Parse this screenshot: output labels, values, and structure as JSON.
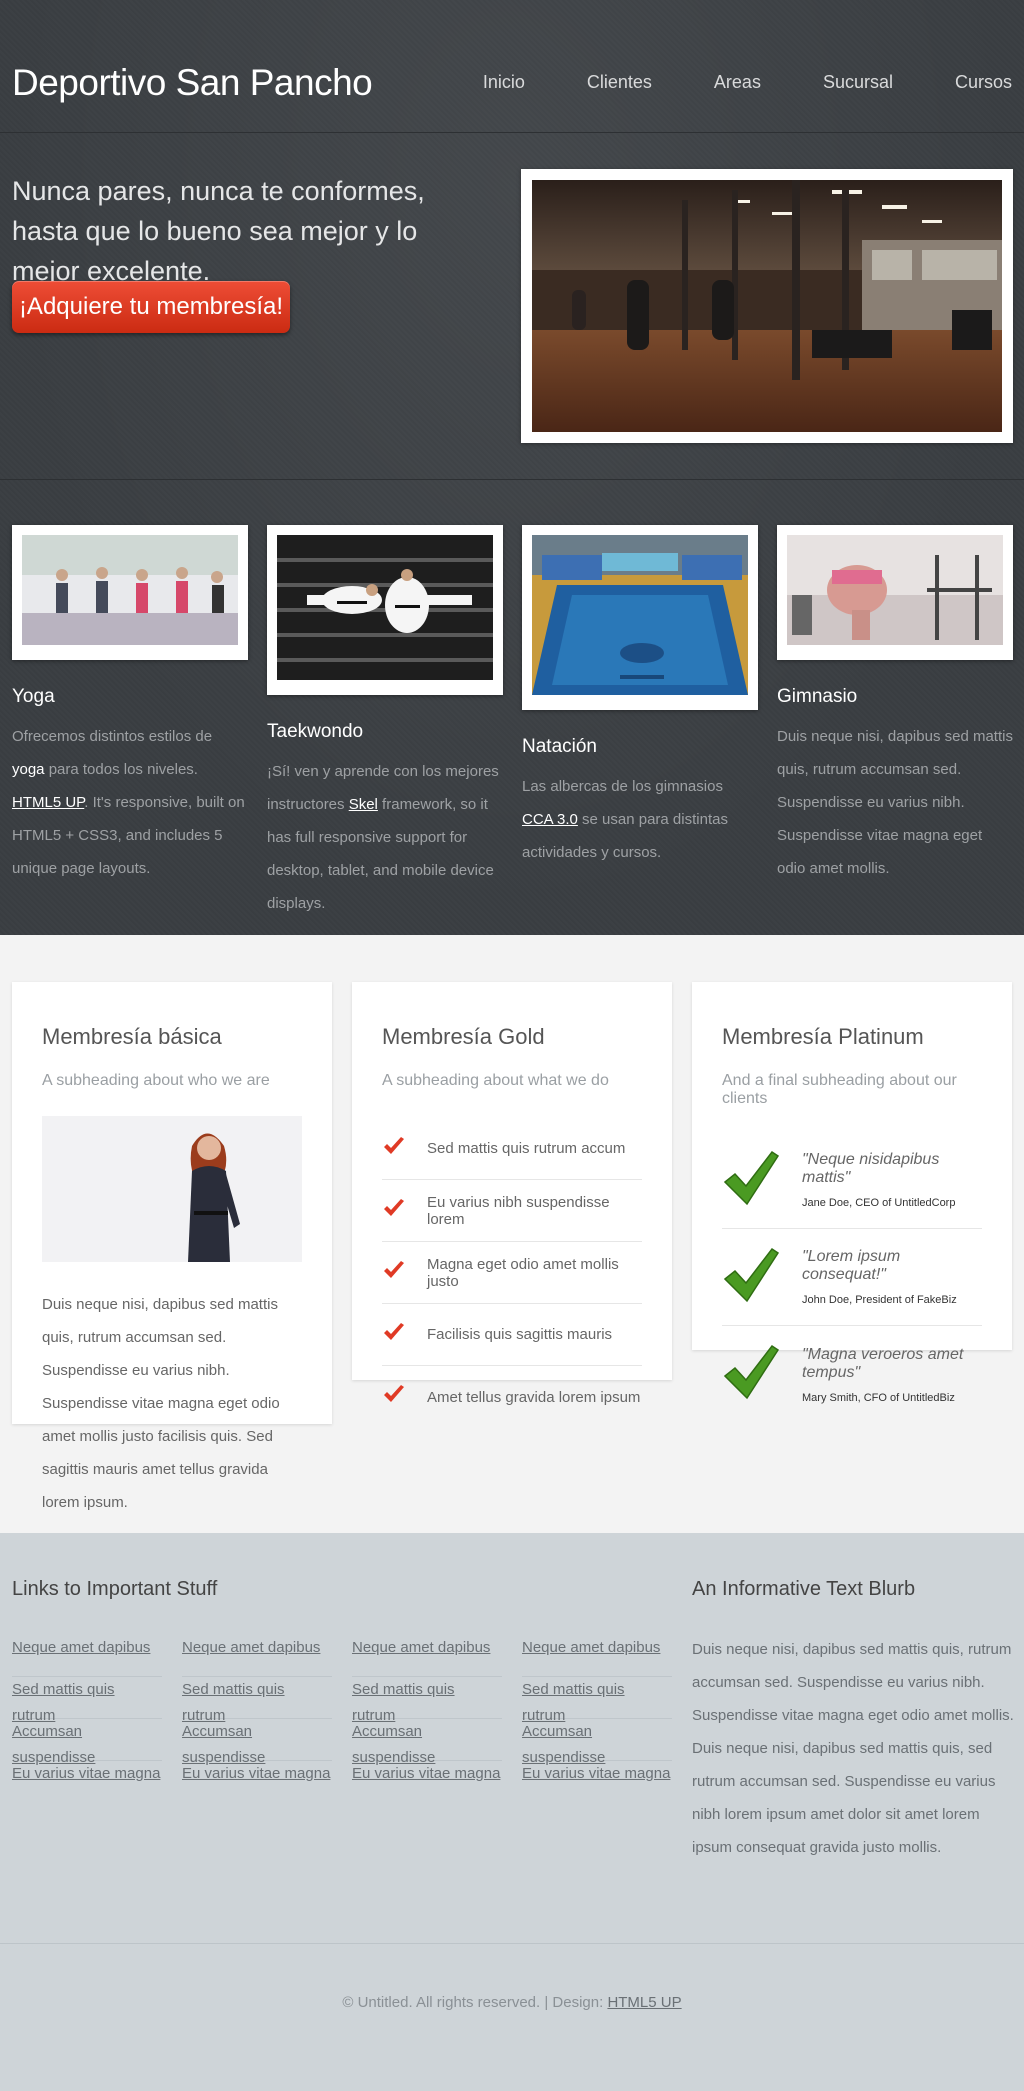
{
  "site": {
    "title": "Deportivo San Pancho"
  },
  "nav": {
    "items": [
      "Inicio",
      "Clientes",
      "Areas",
      "Sucursal",
      "Cursos"
    ]
  },
  "banner": {
    "tagline": "Nunca pares, nunca te conformes, hasta que lo bueno sea mejor y lo mejor excelente.",
    "cta_label": "¡Adquiere tu membresía!",
    "image_alt": "gym-interior"
  },
  "features": [
    {
      "title": "Yoga",
      "image": "yoga-class",
      "text_before": "Ofrecemos distintos estilos de ",
      "strong": "yoga",
      "text_mid": " para todos los niveles. ",
      "link": "HTML5 UP",
      "text_after": ". It's responsive, built on HTML5 + CSS3, and includes 5 unique page layouts."
    },
    {
      "title": "Taekwondo",
      "image": "taekwondo-fighters",
      "text_before": "¡Sí! ven y aprende con los mejores instructores ",
      "link": "Skel",
      "text_after": " framework, so it has full responsive support for desktop, tablet, and mobile device displays."
    },
    {
      "title": "Natación",
      "image": "swimming-pool",
      "text_before": "Las albercas de los gimnasios ",
      "link": "CCA 3.0",
      "text_after": " se usan para distintas actividades y cursos."
    },
    {
      "title": "Gimnasio",
      "image": "gym-training",
      "text_before": "Duis neque nisi, dapibus sed mattis quis, rutrum accumsan sed. Suspendisse eu varius nibh. Suspendisse vitae magna eget odio amet mollis."
    }
  ],
  "boxes": {
    "basic": {
      "title": "Membresía básica",
      "subtitle": "A subheading about who we are",
      "text": "Duis neque nisi, dapibus sed mattis quis, rutrum accumsan sed. Suspendisse eu varius nibh. Suspendisse vitae magna eget odio amet mollis justo facilisis quis. Sed sagittis mauris amet tellus gravida lorem ipsum."
    },
    "gold": {
      "title": "Membresía Gold",
      "subtitle": "A subheading about what we do",
      "items": [
        "Sed mattis quis rutrum accum",
        "Eu varius nibh suspendisse lorem",
        "Magna eget odio amet mollis justo",
        "Facilisis quis sagittis mauris",
        "Amet tellus gravida lorem ipsum"
      ]
    },
    "platinum": {
      "title": "Membresía Platinum",
      "subtitle": "And a final subheading about our clients",
      "quotes": [
        {
          "quote": "\"Neque nisidapibus mattis\"",
          "who": "Jane Doe, CEO of UntitledCorp"
        },
        {
          "quote": "\"Lorem ipsum consequat!\"",
          "who": "John Doe, President of FakeBiz"
        },
        {
          "quote": "\"Magna veroeros amet tempus\"",
          "who": "Mary Smith, CFO of UntitledBiz"
        }
      ]
    }
  },
  "footer": {
    "links_title": "Links to Important Stuff",
    "link_columns": [
      [
        "Neque amet dapibus",
        "Sed mattis quis rutrum",
        "Accumsan suspendisse",
        "Eu varius vitae magna"
      ],
      [
        "Neque amet dapibus",
        "Sed mattis quis rutrum",
        "Accumsan suspendisse",
        "Eu varius vitae magna"
      ],
      [
        "Neque amet dapibus",
        "Sed mattis quis rutrum",
        "Accumsan suspendisse",
        "Eu varius vitae magna"
      ],
      [
        "Neque amet dapibus",
        "Sed mattis quis rutrum",
        "Accumsan suspendisse",
        "Eu varius vitae magna"
      ]
    ],
    "blurb_title": "An Informative Text Blurb",
    "blurb": "Duis neque nisi, dapibus sed mattis quis, rutrum accumsan sed. Suspendisse eu varius nibh. Suspendisse vitae magna eget odio amet mollis. Duis neque nisi, dapibus sed mattis quis, sed rutrum accumsan sed. Suspendisse eu varius nibh lorem ipsum amet dolor sit amet lorem ipsum consequat gravida justo mollis.",
    "copyright": "© Untitled. All rights reserved. | Design: ",
    "design_link": "HTML5 UP"
  },
  "colors": {
    "accent": "#d63a1f",
    "check": "#e03a25",
    "green_check": "#4a9a22",
    "header_bg": "#3a3e42",
    "footer_bg": "#ced4d8"
  }
}
